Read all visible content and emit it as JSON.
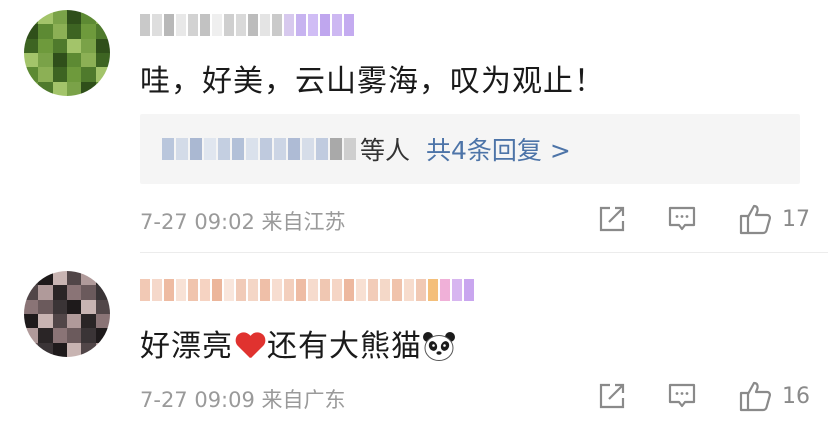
{
  "comments": [
    {
      "username_hidden": true,
      "text": "哇，好美，云山雾海，叹为观止！",
      "reply_summary": {
        "suffix": "等人",
        "link": "共4条回复 >"
      },
      "time": "7-27 09:02",
      "location": "来自江苏",
      "likes": "17"
    },
    {
      "username_hidden": true,
      "text_before": "好漂亮",
      "text_after": "还有大熊猫",
      "emoji": [
        "red-heart",
        "panda"
      ],
      "time": "7-27 09:09",
      "location": "来自广东",
      "likes": "16"
    }
  ],
  "colors": {
    "link": "#4d74a8",
    "meta": "#9a9a9a",
    "heart": "#e0322f",
    "reply_bg": "#f5f5f5"
  }
}
